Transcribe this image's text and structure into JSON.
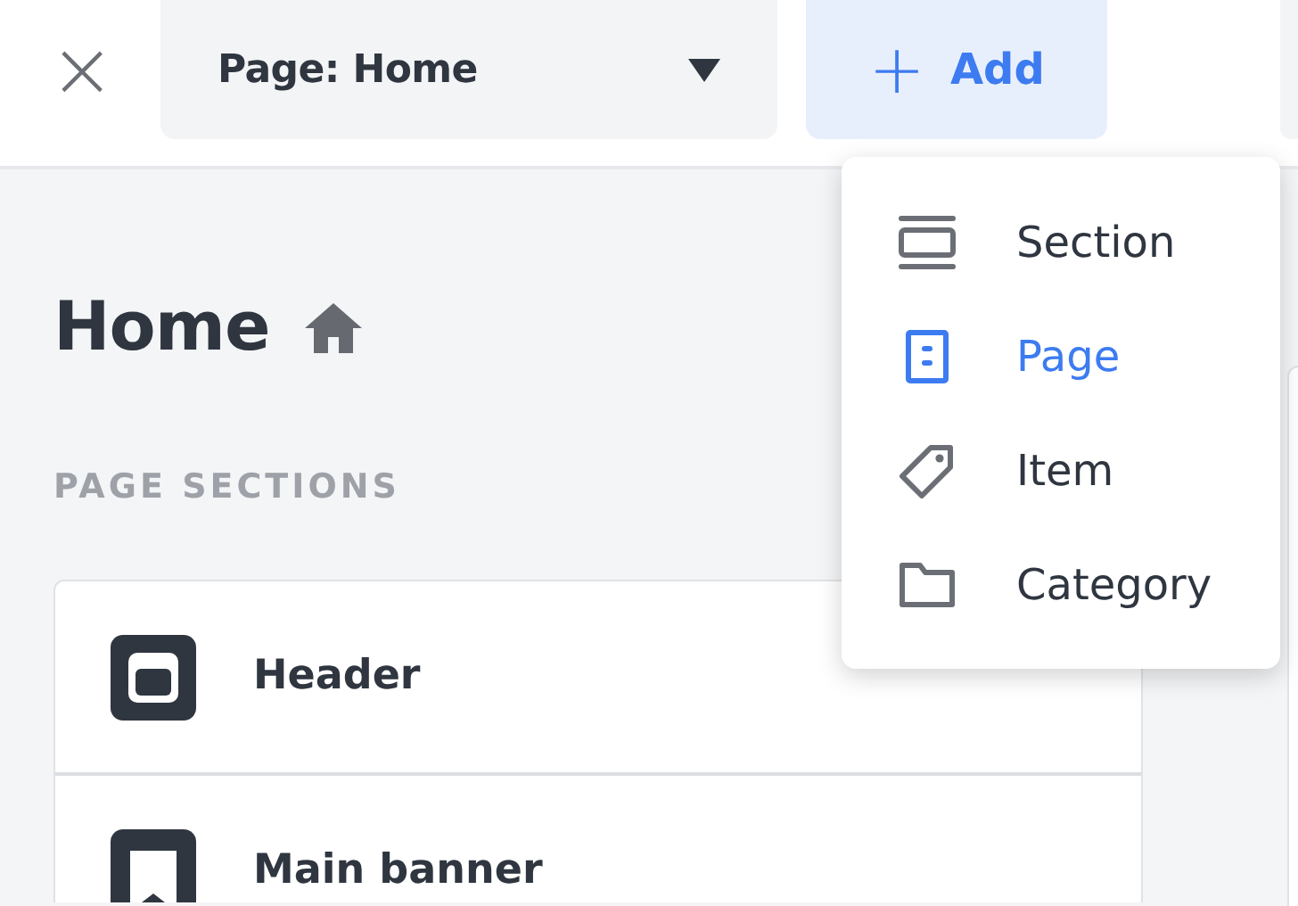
{
  "toolbar": {
    "close": "×",
    "page_select": {
      "label": "Page: Home"
    },
    "add_button": {
      "label": "Add",
      "icon": "+"
    }
  },
  "page": {
    "title": "Home",
    "section_label": "PAGE SECTIONS"
  },
  "sections": [
    {
      "name": "Header",
      "kind": "header"
    },
    {
      "name": "Main banner",
      "kind": "banner"
    }
  ],
  "add_menu": {
    "open": true,
    "items": [
      {
        "label": "Section",
        "kind": "section",
        "selected": false
      },
      {
        "label": "Page",
        "kind": "page",
        "selected": true
      },
      {
        "label": "Item",
        "kind": "item",
        "selected": false
      },
      {
        "label": "Category",
        "kind": "category",
        "selected": false
      }
    ]
  }
}
